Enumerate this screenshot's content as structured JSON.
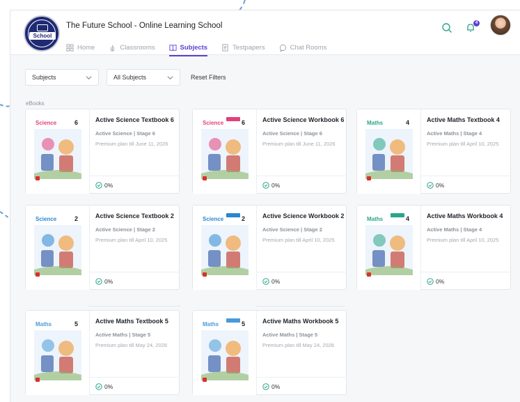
{
  "header": {
    "school_name": "The Future School - Online Learning School",
    "logo_text": "School",
    "notification_count": "4",
    "nav": [
      {
        "label": "Home",
        "icon": "grid-icon"
      },
      {
        "label": "Classrooms",
        "icon": "hand-icon"
      },
      {
        "label": "Subjects",
        "icon": "book-icon"
      },
      {
        "label": "Testpapers",
        "icon": "document-icon"
      },
      {
        "label": "Chat Rooms",
        "icon": "chat-icon"
      }
    ]
  },
  "filters": {
    "subject_select": "Subjects",
    "series_select": "All Subjects",
    "reset_label": "Reset Filters"
  },
  "section_label": "eBooks",
  "books": [
    {
      "title": "Active Science Textbook 6",
      "series": "Active Science | Stage 6",
      "plan": "Premium plan till June 11, 2026",
      "progress": "0%",
      "cover_subject": "Science",
      "cover_stage": "6",
      "color": "#e2417b"
    },
    {
      "title": "Active Science Workbook 6",
      "series": "Active Science | Stage 6",
      "plan": "Premium plan till June 11, 2026",
      "progress": "0%",
      "cover_subject": "Science",
      "cover_stage": "6",
      "color": "#e2417b"
    },
    {
      "title": "Active Maths Textbook 4",
      "series": "Active Maths | Stage 4",
      "plan": "Premium plan till April 10, 2025",
      "progress": "0%",
      "cover_subject": "Maths",
      "cover_stage": "4",
      "color": "#2aa48a"
    },
    {
      "title": "Active Science Textbook 2",
      "series": "Active Science | Stage 2",
      "plan": "Premium plan till April 10, 2025",
      "progress": "0%",
      "cover_subject": "Science",
      "cover_stage": "2",
      "color": "#2a86cf"
    },
    {
      "title": "Active Science Workbook 2",
      "series": "Active Science | Stage 2",
      "plan": "Premium plan till April 10, 2025",
      "progress": "0%",
      "cover_subject": "Science",
      "cover_stage": "2",
      "color": "#2a86cf"
    },
    {
      "title": "Active Maths Workbook 4",
      "series": "Active Maths | Stage 4",
      "plan": "Premium plan till April 10, 2025",
      "progress": "0%",
      "cover_subject": "Maths",
      "cover_stage": "4",
      "color": "#2aa48a"
    },
    {
      "title": "Active Maths Textbook 5",
      "series": "Active Maths | Stage 5",
      "plan": "Premium plan till May 24, 2028",
      "progress": "0%",
      "cover_subject": "Maths",
      "cover_stage": "5",
      "color": "#4a9ad8"
    },
    {
      "title": "Active Maths Workbook 5",
      "series": "Active Maths | Stage 5",
      "plan": "Premium plan till May 24, 2028",
      "progress": "0%",
      "cover_subject": "Maths",
      "cover_stage": "5",
      "color": "#4a9ad8"
    }
  ],
  "colors": {
    "accent": "#5b3fd0",
    "annotation": "#6b9fd8",
    "navy": "#1f2a73"
  }
}
